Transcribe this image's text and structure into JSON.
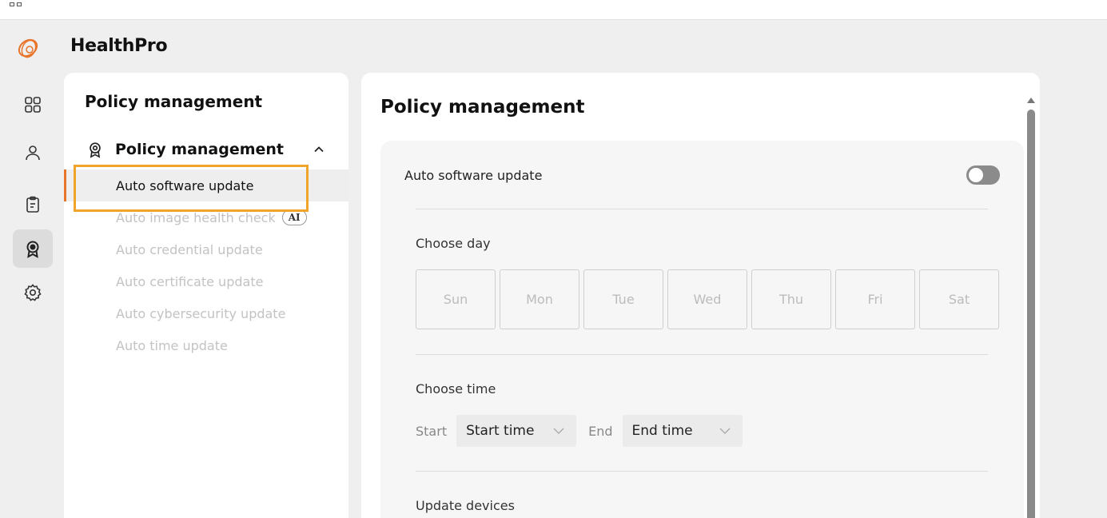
{
  "app": {
    "name": "HealthPro"
  },
  "colors": {
    "accent": "#e8742a",
    "highlight": "#f0a52a"
  },
  "rail": [
    {
      "icon": "dashboard-grid-icon",
      "active": false
    },
    {
      "icon": "user-icon",
      "active": false
    },
    {
      "icon": "clipboard-icon",
      "active": false
    },
    {
      "icon": "badge-icon",
      "active": true
    },
    {
      "icon": "gear-icon",
      "active": false
    }
  ],
  "subnav": {
    "title": "Policy management",
    "group": {
      "label": "Policy management",
      "icon": "badge-icon",
      "expanded": true
    },
    "items": [
      {
        "label": "Auto software update",
        "active": true
      },
      {
        "label": "Auto image health check",
        "badge": "AI"
      },
      {
        "label": "Auto credential update"
      },
      {
        "label": "Auto certificate update"
      },
      {
        "label": "Auto cybersecurity update"
      },
      {
        "label": "Auto time update"
      }
    ]
  },
  "main": {
    "title": "Policy management",
    "card": {
      "label": "Auto software update",
      "toggle_on": false,
      "choose_day": {
        "label": "Choose day",
        "days": [
          "Sun",
          "Mon",
          "Tue",
          "Wed",
          "Thu",
          "Fri",
          "Sat"
        ]
      },
      "choose_time": {
        "label": "Choose time",
        "start_label": "Start",
        "start_value": "Start time",
        "end_label": "End",
        "end_value": "End time"
      },
      "update_devices": {
        "label": "Update devices"
      }
    }
  }
}
